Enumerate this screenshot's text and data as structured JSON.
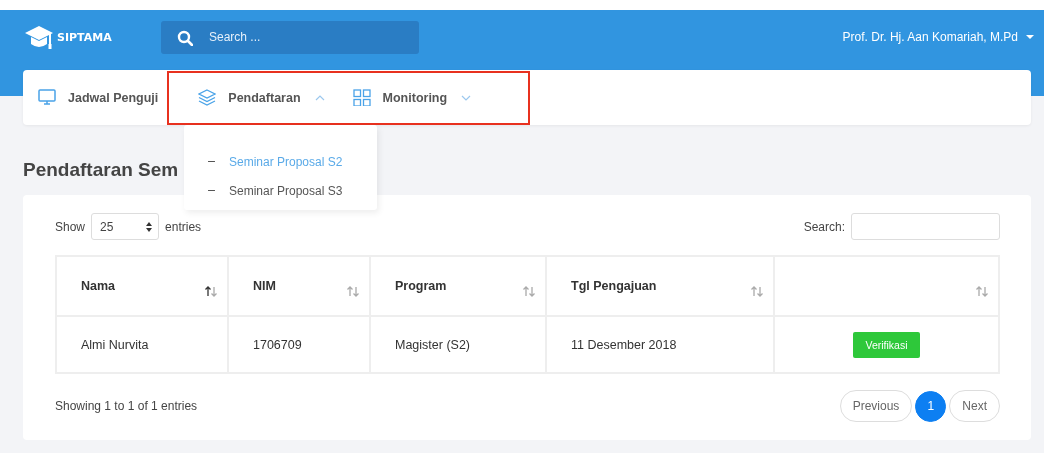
{
  "header": {
    "logo_text": "SIPTAMA",
    "search": {
      "placeholder": "Search ..."
    },
    "user": "Prof. Dr. Hj. Aan Komariah, M.Pd"
  },
  "nav": [
    {
      "kind": "link",
      "label": "Jadwal Penguji"
    },
    {
      "kind": "menu",
      "label": "Pendaftaran",
      "expanded": true,
      "children": [
        {
          "label": "Seminar Proposal S2",
          "selected": true
        },
        {
          "label": "Seminar Proposal S3",
          "selected": false
        }
      ]
    },
    {
      "kind": "menu",
      "label": "Monitoring",
      "expanded": false
    }
  ],
  "page_title": "Pendaftaran Sem",
  "table": {
    "length_label_before": "Show",
    "length_value": "25",
    "length_label_after": "entries",
    "search_label": "Search:",
    "columns": [
      {
        "label": "Nama",
        "sorted": true
      },
      {
        "label": "NIM",
        "sorted": false
      },
      {
        "label": "Program",
        "sorted": false
      },
      {
        "label": "Tgl Pengajuan",
        "sorted": false
      },
      {
        "sorted": false
      }
    ],
    "rows": [
      {
        "cells": [
          "Almi Nurvita",
          "1706709",
          "Magister (S2)",
          "11 Desember 2018"
        ],
        "action": "Verifikasi"
      }
    ],
    "info": "Showing 1 to 1 of 1 entries",
    "pages": [
      {
        "label": "Previous",
        "selected": false
      },
      {
        "label": "1",
        "selected": true
      },
      {
        "label": "Next",
        "selected": false
      }
    ]
  }
}
